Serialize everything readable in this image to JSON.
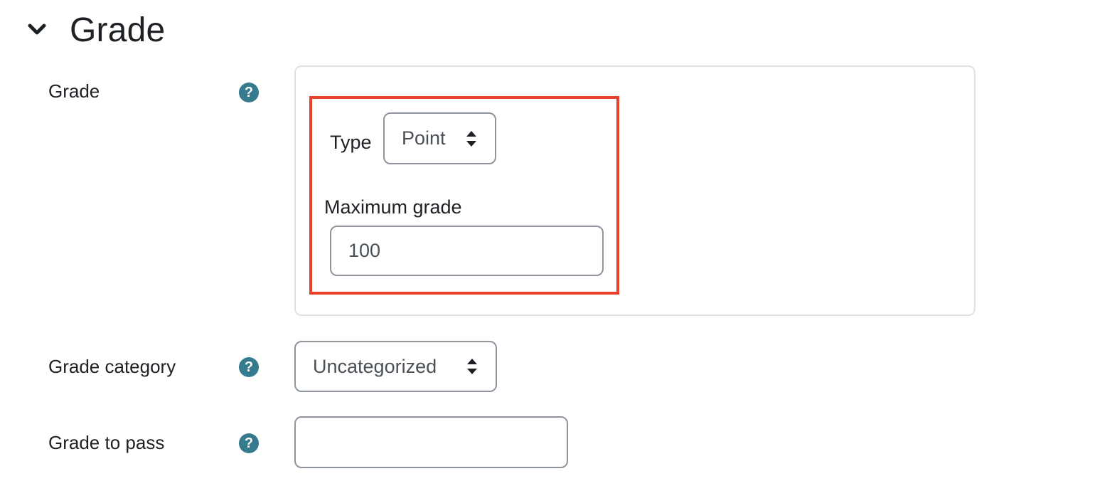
{
  "section": {
    "title": "Grade",
    "toggle_icon": "chevron-down-icon"
  },
  "grade": {
    "label": "Grade",
    "help_icon": "question-circle-icon",
    "type_label": "Type",
    "type_value": "Point",
    "max_grade_label": "Maximum grade",
    "max_grade_value": "100"
  },
  "grade_category": {
    "label": "Grade category",
    "help_icon": "question-circle-icon",
    "value": "Uncategorized"
  },
  "grade_to_pass": {
    "label": "Grade to pass",
    "help_icon": "question-circle-icon",
    "value": ""
  },
  "colors": {
    "help_icon": "#357a8d",
    "highlight": "#e8412c",
    "text": "#1d2125",
    "input_border": "#8f959e",
    "fieldset_border": "#dee2e6"
  }
}
